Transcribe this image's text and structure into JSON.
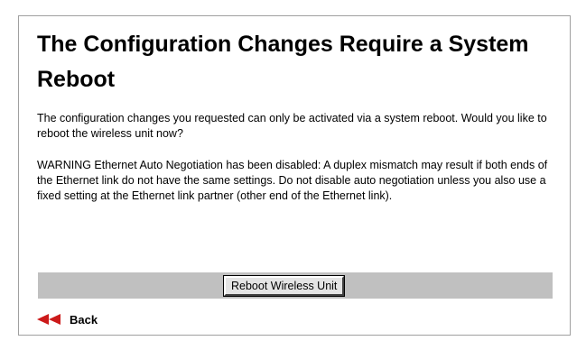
{
  "page": {
    "title": "The Configuration Changes Require a System Reboot",
    "paragraph_1": "The configuration changes you requested can only be activated via a system reboot. Would you like to reboot the wireless unit now?",
    "paragraph_2": "WARNING Ethernet Auto Negotiation has been disabled: A duplex mismatch may result if both ends of the Ethernet link do not have the same settings. Do not disable auto negotiation unless you also use a fixed setting at the Ethernet link partner (other end of the Ethernet link)."
  },
  "actions": {
    "reboot_label": "Reboot Wireless Unit",
    "back_label": "Back",
    "back_icon": "double-left-arrow-icon"
  },
  "colors": {
    "button_bar": "#c0c0c0",
    "back_arrow": "#cc1a1a",
    "frame_border": "#a0a0a0"
  }
}
